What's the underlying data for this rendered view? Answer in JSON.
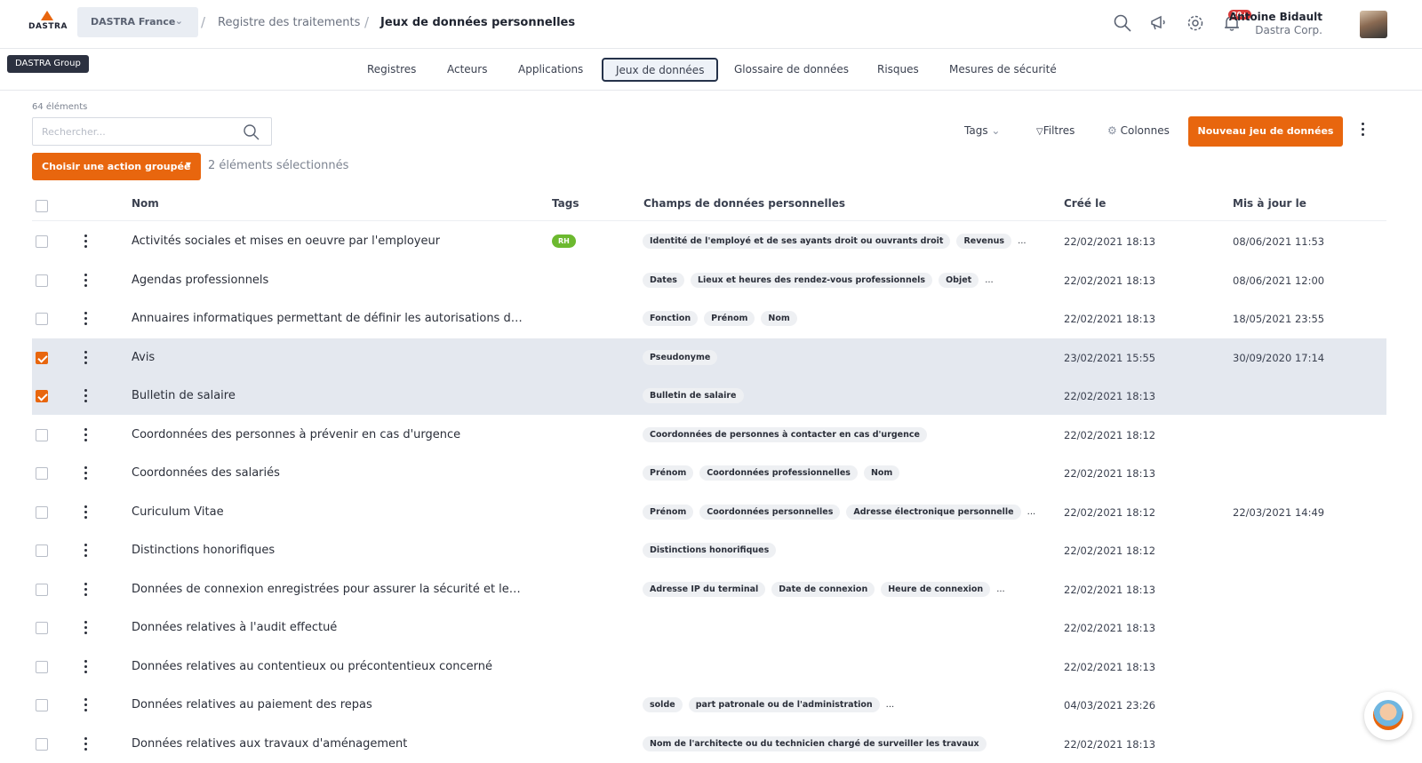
{
  "header": {
    "logo_text": "DASTRA",
    "org": "DASTRA France",
    "tooltip": "DASTRA Group",
    "breadcrumb": [
      "Registre des traitements",
      "Jeux de données personnelles"
    ],
    "notif_badge": "20+",
    "user_name": "Antoine Bidault",
    "user_org": "Dastra Corp."
  },
  "tabs": [
    "Registres",
    "Acteurs",
    "Applications",
    "Jeux de données",
    "Glossaire de données",
    "Risques",
    "Mesures de sécurité"
  ],
  "active_tab": "Jeux de données",
  "toolbar": {
    "count": "64 éléments",
    "search_placeholder": "Rechercher...",
    "tags": "Tags",
    "filters": "Filtres",
    "columns": "Colonnes",
    "new_button": "Nouveau jeu de données",
    "group_action": "Choisir une action groupée",
    "selected_text": "2 éléments sélectionnés"
  },
  "table": {
    "headers": {
      "name": "Nom",
      "tags": "Tags",
      "fields": "Champs de données personnelles",
      "created": "Créé le",
      "updated": "Mis à jour le"
    },
    "rows": [
      {
        "name": "Activités sociales et mises en oeuvre par l'employeur",
        "tag": "RH",
        "fields": [
          "Identité de l'employé et de ses ayants droit ou ouvrants droit",
          "Revenus"
        ],
        "more": true,
        "created": "22/02/2021 18:13",
        "updated": "08/06/2021 11:53",
        "selected": false
      },
      {
        "name": "Agendas professionnels",
        "tag": "",
        "fields": [
          "Dates",
          "Lieux et heures des rendez-vous professionnels",
          "Objet"
        ],
        "more": true,
        "created": "22/02/2021 18:13",
        "updated": "08/06/2021 12:00",
        "selected": false
      },
      {
        "name": "Annuaires informatiques permettant de définir les autorisations d'accès aux applications et réseaux",
        "tag": "",
        "fields": [
          "Fonction",
          "Prénom",
          "Nom"
        ],
        "more": false,
        "created": "22/02/2021 18:13",
        "updated": "18/05/2021 23:55",
        "selected": false
      },
      {
        "name": "Avis",
        "tag": "",
        "fields": [
          "Pseudonyme"
        ],
        "more": false,
        "created": "23/02/2021 15:55",
        "updated": "30/09/2020 17:14",
        "selected": true
      },
      {
        "name": "Bulletin de salaire",
        "tag": "",
        "fields": [
          "Bulletin de salaire"
        ],
        "more": false,
        "created": "22/02/2021 18:13",
        "updated": "",
        "selected": true
      },
      {
        "name": "Coordonnées des personnes à prévenir en cas d'urgence",
        "tag": "",
        "fields": [
          "Coordonnées de personnes à contacter en cas d'urgence"
        ],
        "more": false,
        "created": "22/02/2021 18:12",
        "updated": "",
        "selected": false
      },
      {
        "name": "Coordonnées des salariés",
        "tag": "",
        "fields": [
          "Prénom",
          "Coordonnées professionnelles",
          "Nom"
        ],
        "more": false,
        "created": "22/02/2021 18:13",
        "updated": "",
        "selected": false
      },
      {
        "name": "Curiculum Vitae",
        "tag": "",
        "fields": [
          "Prénom",
          "Coordonnées personnelles",
          "Adresse électronique personnelle"
        ],
        "more": true,
        "created": "22/02/2021 18:12",
        "updated": "22/03/2021 14:49",
        "selected": false
      },
      {
        "name": "Distinctions honorifiques",
        "tag": "",
        "fields": [
          "Distinctions honorifiques"
        ],
        "more": false,
        "created": "22/02/2021 18:12",
        "updated": "",
        "selected": false
      },
      {
        "name": "Données de connexion enregistrées pour assurer la sécurité et le bon fonctionnement",
        "tag": "",
        "fields": [
          "Adresse IP du terminal",
          "Date de connexion",
          "Heure de connexion"
        ],
        "more": true,
        "created": "22/02/2021 18:13",
        "updated": "",
        "selected": false
      },
      {
        "name": "Données relatives à l'audit effectué",
        "tag": "",
        "fields": [],
        "more": false,
        "created": "22/02/2021 18:13",
        "updated": "",
        "selected": false
      },
      {
        "name": "Données relatives au contentieux ou précontentieux concerné",
        "tag": "",
        "fields": [],
        "more": false,
        "created": "22/02/2021 18:13",
        "updated": "",
        "selected": false
      },
      {
        "name": "Données relatives au paiement des repas",
        "tag": "",
        "fields": [
          "solde",
          "part patronale ou de l'administration"
        ],
        "more": true,
        "created": "04/03/2021 23:26",
        "updated": "",
        "selected": false
      },
      {
        "name": "Données relatives aux travaux d'aménagement",
        "tag": "",
        "fields": [
          "Nom de l'architecte ou du technicien chargé de surveiller les travaux"
        ],
        "more": false,
        "created": "22/02/2021 18:13",
        "updated": "",
        "selected": false
      }
    ]
  },
  "colors": {
    "accent": "#e8660e",
    "tag_green": "#6cb92f",
    "selected_row": "#e4e8ef",
    "badge_red": "#d83a3a"
  }
}
